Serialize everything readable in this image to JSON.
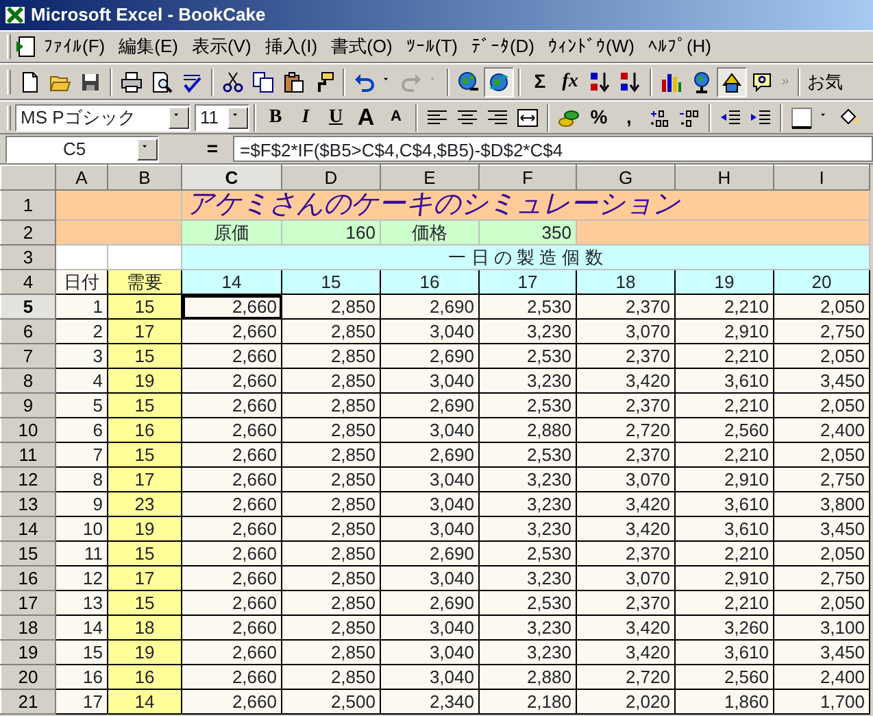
{
  "window": {
    "title": "Microsoft Excel - BookCake"
  },
  "menu": [
    "ﾌｧｲﾙ(F)",
    "編集(E)",
    "表示(V)",
    "挿入(I)",
    "書式(O)",
    "ﾂｰﾙ(T)",
    "ﾃﾞｰﾀ(D)",
    "ｳｨﾝﾄﾞｳ(W)",
    "ﾍﾙﾌﾟ(H)"
  ],
  "standard_toolbar": {
    "sum": "Σ",
    "function": "fx",
    "overflow_text": "お気",
    "redo_disabled": true,
    "web_pressed": true,
    "drawing_pressed": true
  },
  "formatting_toolbar": {
    "font": "MS Pゴシック",
    "size": "11",
    "bold": "B",
    "italic": "I",
    "underline": "U",
    "grow_font": "A",
    "shrink_font": "A",
    "percent": "%",
    "comma": ","
  },
  "formula_bar": {
    "name_box": "C5",
    "equals": "=",
    "formula": "=$F$2*IF($B5>C$4,C$4,$B5)-$D$2*C$4"
  },
  "sheet": {
    "columns": [
      {
        "label": "A",
        "selected": false
      },
      {
        "label": "B",
        "selected": false
      },
      {
        "label": "C",
        "selected": true
      },
      {
        "label": "D",
        "selected": false
      },
      {
        "label": "E",
        "selected": false
      },
      {
        "label": "F",
        "selected": false
      },
      {
        "label": "G",
        "selected": false
      },
      {
        "label": "H",
        "selected": false
      },
      {
        "label": "I",
        "selected": false
      }
    ],
    "title_row": {
      "header": "1",
      "selected": false,
      "title": "アケミさんのケーキのシミュレーション"
    },
    "price_row": {
      "header": "2",
      "selected": false,
      "cost_label": "原価",
      "cost": "160",
      "price_label": "価格",
      "price": "350"
    },
    "banner_row": {
      "header": "3",
      "selected": false,
      "banner": "一 日 の 製 造 個 数"
    },
    "label_row": {
      "header": "4",
      "selected": false,
      "date_label": "日付",
      "demand_label": "需要",
      "quantities": [
        "14",
        "15",
        "16",
        "17",
        "18",
        "19",
        "20"
      ]
    },
    "rows": [
      {
        "header": "5",
        "selected": true,
        "date": "1",
        "demand": "15",
        "values": [
          "2,660",
          "2,850",
          "2,690",
          "2,530",
          "2,370",
          "2,210",
          "2,050"
        ]
      },
      {
        "header": "6",
        "selected": false,
        "date": "2",
        "demand": "17",
        "values": [
          "2,660",
          "2,850",
          "3,040",
          "3,230",
          "3,070",
          "2,910",
          "2,750"
        ]
      },
      {
        "header": "7",
        "selected": false,
        "date": "3",
        "demand": "15",
        "values": [
          "2,660",
          "2,850",
          "2,690",
          "2,530",
          "2,370",
          "2,210",
          "2,050"
        ]
      },
      {
        "header": "8",
        "selected": false,
        "date": "4",
        "demand": "19",
        "values": [
          "2,660",
          "2,850",
          "3,040",
          "3,230",
          "3,420",
          "3,610",
          "3,450"
        ]
      },
      {
        "header": "9",
        "selected": false,
        "date": "5",
        "demand": "15",
        "values": [
          "2,660",
          "2,850",
          "2,690",
          "2,530",
          "2,370",
          "2,210",
          "2,050"
        ]
      },
      {
        "header": "10",
        "selected": false,
        "date": "6",
        "demand": "16",
        "values": [
          "2,660",
          "2,850",
          "3,040",
          "2,880",
          "2,720",
          "2,560",
          "2,400"
        ]
      },
      {
        "header": "11",
        "selected": false,
        "date": "7",
        "demand": "15",
        "values": [
          "2,660",
          "2,850",
          "2,690",
          "2,530",
          "2,370",
          "2,210",
          "2,050"
        ]
      },
      {
        "header": "12",
        "selected": false,
        "date": "8",
        "demand": "17",
        "values": [
          "2,660",
          "2,850",
          "3,040",
          "3,230",
          "3,070",
          "2,910",
          "2,750"
        ]
      },
      {
        "header": "13",
        "selected": false,
        "date": "9",
        "demand": "23",
        "values": [
          "2,660",
          "2,850",
          "3,040",
          "3,230",
          "3,420",
          "3,610",
          "3,800"
        ]
      },
      {
        "header": "14",
        "selected": false,
        "date": "10",
        "demand": "19",
        "values": [
          "2,660",
          "2,850",
          "3,040",
          "3,230",
          "3,420",
          "3,610",
          "3,450"
        ]
      },
      {
        "header": "15",
        "selected": false,
        "date": "11",
        "demand": "15",
        "values": [
          "2,660",
          "2,850",
          "2,690",
          "2,530",
          "2,370",
          "2,210",
          "2,050"
        ]
      },
      {
        "header": "16",
        "selected": false,
        "date": "12",
        "demand": "17",
        "values": [
          "2,660",
          "2,850",
          "3,040",
          "3,230",
          "3,070",
          "2,910",
          "2,750"
        ]
      },
      {
        "header": "17",
        "selected": false,
        "date": "13",
        "demand": "15",
        "values": [
          "2,660",
          "2,850",
          "2,690",
          "2,530",
          "2,370",
          "2,210",
          "2,050"
        ]
      },
      {
        "header": "18",
        "selected": false,
        "date": "14",
        "demand": "18",
        "values": [
          "2,660",
          "2,850",
          "3,040",
          "3,230",
          "3,420",
          "3,260",
          "3,100"
        ]
      },
      {
        "header": "19",
        "selected": false,
        "date": "15",
        "demand": "19",
        "values": [
          "2,660",
          "2,850",
          "3,040",
          "3,230",
          "3,420",
          "3,610",
          "3,450"
        ]
      },
      {
        "header": "20",
        "selected": false,
        "date": "16",
        "demand": "16",
        "values": [
          "2,660",
          "2,850",
          "3,040",
          "2,880",
          "2,720",
          "2,560",
          "2,400"
        ]
      },
      {
        "header": "21",
        "selected": false,
        "date": "17",
        "demand": "14",
        "values": [
          "2,660",
          "2,500",
          "2,340",
          "2,180",
          "2,020",
          "1,860",
          "1,700"
        ]
      }
    ]
  }
}
